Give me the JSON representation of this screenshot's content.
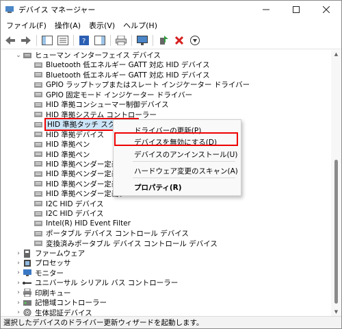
{
  "window": {
    "title": "デバイス マネージャー"
  },
  "menu": [
    "ファイル(F)",
    "操作(A)",
    "表示(V)",
    "ヘルプ(H)"
  ],
  "tree": [
    {
      "label": "ヒューマン インターフェイス デバイス",
      "level": 1,
      "expander": "v",
      "icon": "hid-category-icon"
    },
    {
      "label": "Bluetooth 低エネルギー GATT 対応 HID デバイス",
      "level": 2,
      "icon": "hid-device-icon"
    },
    {
      "label": "Bluetooth 低エネルギー GATT 対応 HID デバイス",
      "level": 2,
      "icon": "hid-device-icon"
    },
    {
      "label": "GPIO ラップトップまたはスレート インジケーター ドライバー",
      "level": 2,
      "icon": "hid-device-icon"
    },
    {
      "label": "GPIO 固定モード インジケーター ドライバー",
      "level": 2,
      "icon": "hid-device-icon"
    },
    {
      "label": "HID 準拠コンシューマー制御デバイス",
      "level": 2,
      "icon": "hid-device-icon"
    },
    {
      "label": "HID 準拠システム コントローラー",
      "level": 2,
      "icon": "hid-device-icon"
    },
    {
      "label": "HID 準拠タッチ スクリーン",
      "level": 2,
      "icon": "hid-device-icon",
      "selected": true
    },
    {
      "label": "HID 準拠デバイス",
      "level": 2,
      "icon": "hid-device-icon"
    },
    {
      "label": "HID 準拠ペン",
      "level": 2,
      "icon": "hid-device-icon"
    },
    {
      "label": "HID 準拠ペン",
      "level": 2,
      "icon": "hid-device-icon"
    },
    {
      "label": "HID 準拠ベンダー定義デバ",
      "level": 2,
      "icon": "hid-device-icon"
    },
    {
      "label": "HID 準拠ベンダー定義デバ",
      "level": 2,
      "icon": "hid-device-icon"
    },
    {
      "label": "HID 準拠ベンダー定義デバ",
      "level": 2,
      "icon": "hid-device-icon"
    },
    {
      "label": "HID 準拠ベンダー定義デバ",
      "level": 2,
      "icon": "hid-device-icon"
    },
    {
      "label": "I2C HID デバイス",
      "level": 2,
      "icon": "hid-device-icon"
    },
    {
      "label": "I2C HID デバイス",
      "level": 2,
      "icon": "hid-device-icon"
    },
    {
      "label": "Intel(R) HID Event Filter",
      "level": 2,
      "icon": "hid-device-icon"
    },
    {
      "label": "ポータブル デバイス コントロール デバイス",
      "level": 2,
      "icon": "hid-device-icon"
    },
    {
      "label": "変換済みポータブル デバイス コントロール デバイス",
      "level": 2,
      "icon": "hid-device-icon"
    },
    {
      "label": "ファームウェア",
      "level": 1,
      "expander": ">",
      "icon": "firmware-icon"
    },
    {
      "label": "プロセッサ",
      "level": 1,
      "expander": ">",
      "icon": "processor-icon"
    },
    {
      "label": "モニター",
      "level": 1,
      "expander": ">",
      "icon": "monitor-icon"
    },
    {
      "label": "ユニバーサル シリアル バス コントローラー",
      "level": 1,
      "expander": ">",
      "icon": "usb-icon"
    },
    {
      "label": "印刷キュー",
      "level": 1,
      "expander": ">",
      "icon": "print-queue-icon"
    },
    {
      "label": "記憶域コントローラー",
      "level": 1,
      "expander": ">",
      "icon": "storage-controller-icon"
    },
    {
      "label": "生体認証デバイス",
      "level": 1,
      "expander": ">",
      "icon": "biometric-icon"
    }
  ],
  "context_menu": {
    "items": [
      {
        "label": "ドライバーの更新(P)"
      },
      {
        "label": "デバイスを無効にする(D)",
        "highlighted": true
      },
      {
        "label": "デバイスのアンインストール(U)"
      },
      {
        "label": "ハードウェア変更のスキャン(A)"
      },
      {
        "label": "プロパティ(R)",
        "bold": true
      }
    ]
  },
  "status_text": "選択したデバイスのドライバー更新ウィザードを起動します。"
}
